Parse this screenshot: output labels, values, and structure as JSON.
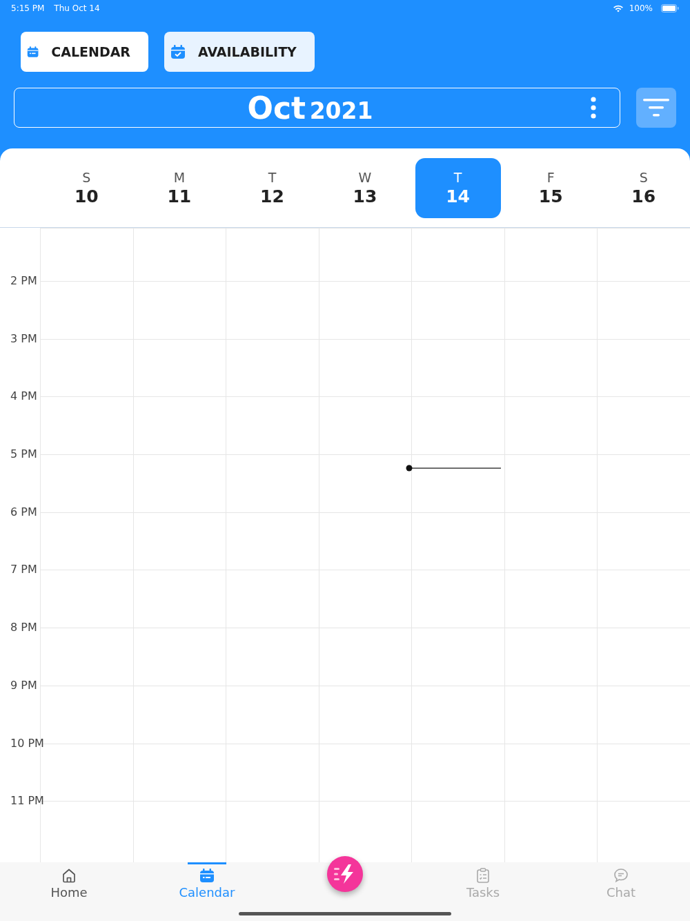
{
  "status_bar": {
    "time": "5:15 PM",
    "date": "Thu Oct 14",
    "battery": "100%"
  },
  "view_buttons": [
    {
      "label": "CALENDAR",
      "kind": "calendar",
      "selected": false
    },
    {
      "label": "AVAILABILITY",
      "kind": "availability",
      "selected": true
    }
  ],
  "month_header": {
    "month": "Oct",
    "year": "2021"
  },
  "days": [
    {
      "weekday": "S",
      "date": "10",
      "selected": false
    },
    {
      "weekday": "M",
      "date": "11",
      "selected": false
    },
    {
      "weekday": "T",
      "date": "12",
      "selected": false
    },
    {
      "weekday": "W",
      "date": "13",
      "selected": false
    },
    {
      "weekday": "T",
      "date": "14",
      "selected": true
    },
    {
      "weekday": "F",
      "date": "15",
      "selected": false
    },
    {
      "weekday": "S",
      "date": "16",
      "selected": false
    }
  ],
  "hours": [
    "2 PM",
    "3 PM",
    "4 PM",
    "5 PM",
    "6 PM",
    "7 PM",
    "8 PM",
    "9 PM",
    "10 PM",
    "11 PM"
  ],
  "tab_bar": [
    {
      "label": "Home",
      "kind": "home",
      "selected": false,
      "disabled": false
    },
    {
      "label": "Calendar",
      "kind": "calendar",
      "selected": true,
      "disabled": false
    },
    {
      "kind": "action"
    },
    {
      "label": "Tasks",
      "kind": "tasks",
      "selected": false,
      "disabled": true
    },
    {
      "label": "Chat",
      "kind": "chat",
      "selected": false,
      "disabled": true
    }
  ]
}
